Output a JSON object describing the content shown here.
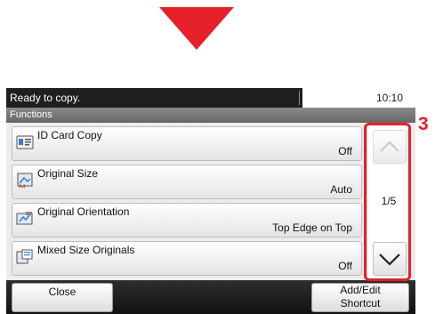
{
  "status_bar": {
    "message": "Ready to copy.",
    "time": "10:10"
  },
  "section_title": "Functions",
  "functions": [
    {
      "title": "ID Card Copy",
      "value": "Off",
      "icon": "id-card-icon"
    },
    {
      "title": "Original Size",
      "value": "Auto",
      "icon": "original-size-icon"
    },
    {
      "title": "Original Orientation",
      "value": "Top Edge on Top",
      "icon": "orientation-icon"
    },
    {
      "title": "Mixed Size Originals",
      "value": "Off",
      "icon": "mixed-size-icon"
    }
  ],
  "scroll": {
    "page_indicator": "1/5"
  },
  "callout_number": "3",
  "bottom": {
    "close_label": "Close",
    "shortcut_line1": "Add/Edit",
    "shortcut_line2": "Shortcut"
  },
  "colors": {
    "accent": "#e6202a",
    "status_bar": "#1f1f1f",
    "panel": "#ececec"
  }
}
